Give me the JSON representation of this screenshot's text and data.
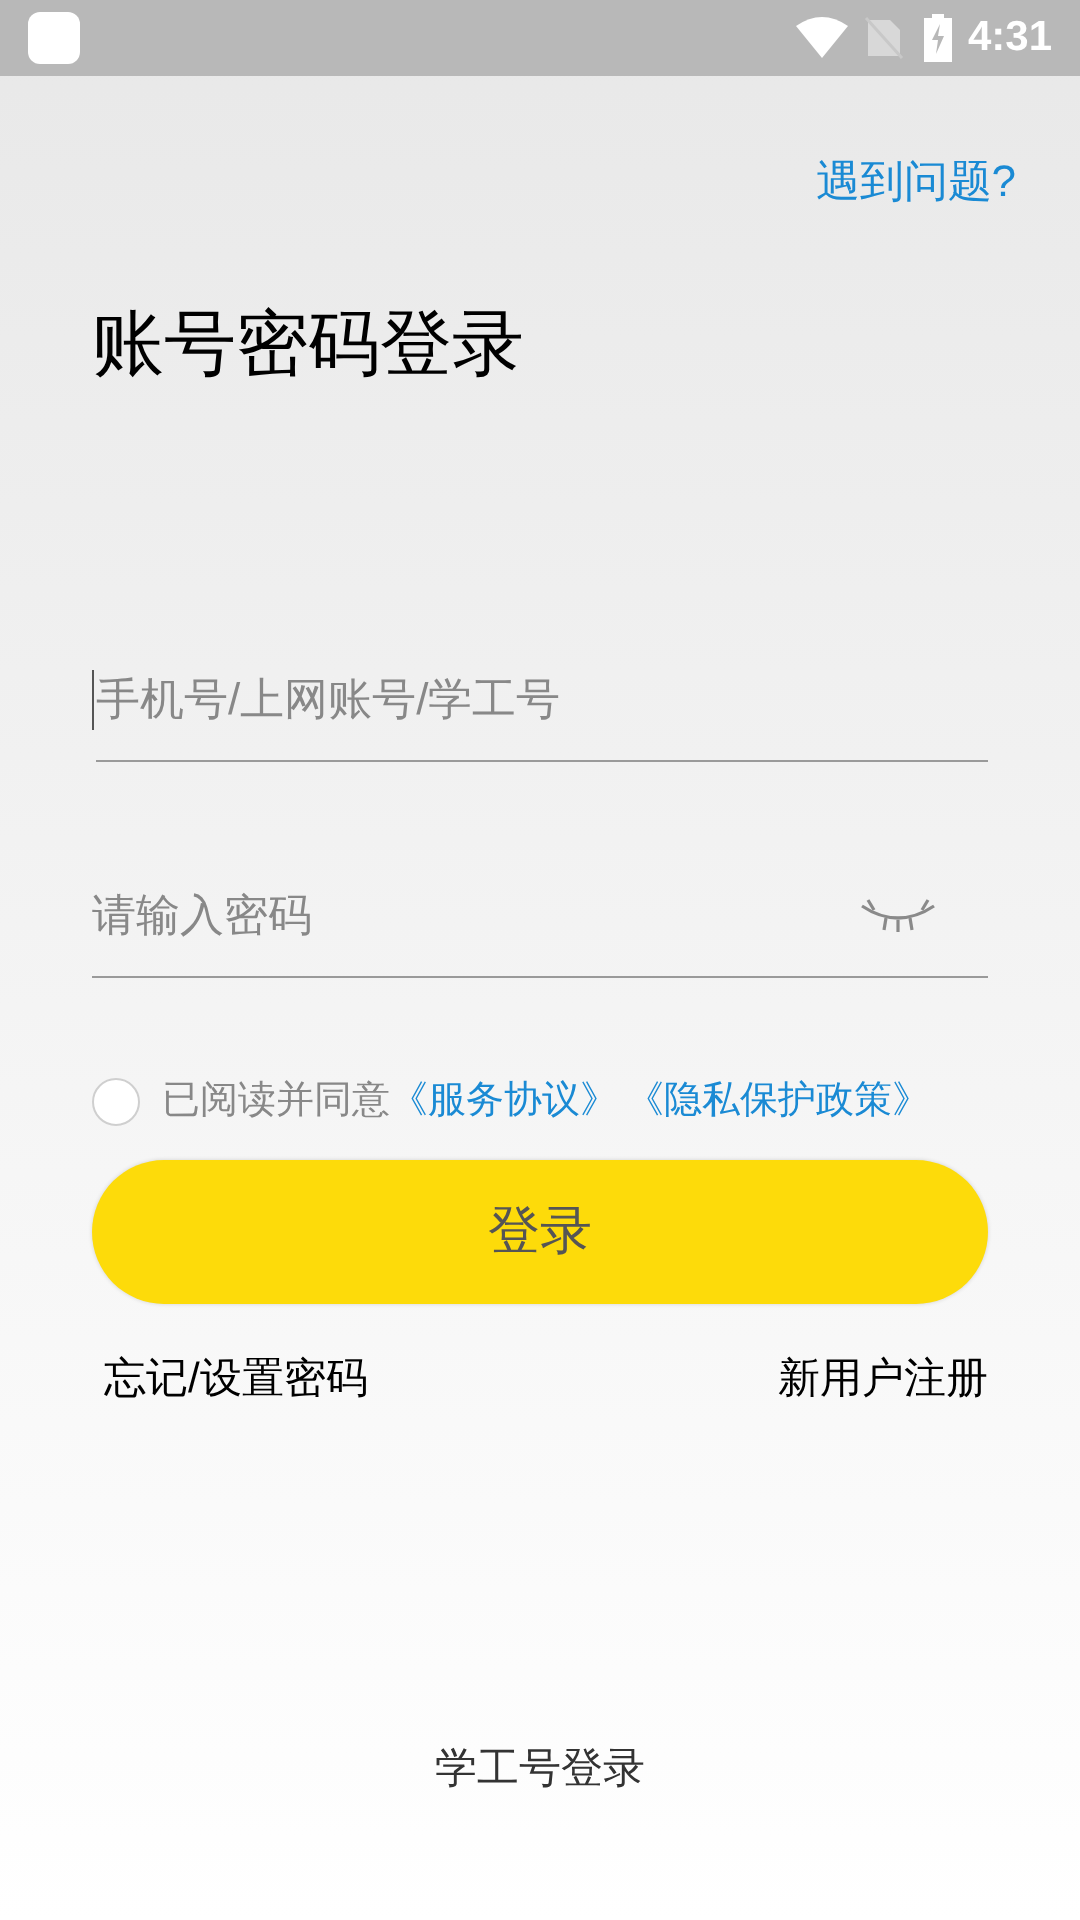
{
  "status_bar": {
    "time": "4:31"
  },
  "help_link": "遇到问题?",
  "title": "账号密码登录",
  "account_field": {
    "placeholder": "手机号/上网账号/学工号"
  },
  "password_field": {
    "placeholder": "请输入密码"
  },
  "agreement": {
    "checked": false,
    "text": "已阅读并同意",
    "links": [
      "《服务协议》",
      "《隐私保护政策》"
    ]
  },
  "login_button": "登录",
  "forgot_link": "忘记/设置密码",
  "register_link": "新用户注册",
  "alt_login": "学工号登录"
}
